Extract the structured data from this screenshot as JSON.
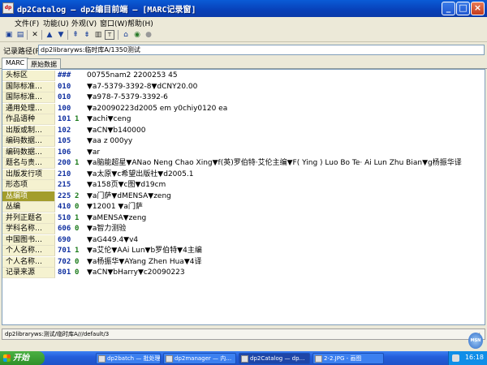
{
  "window": {
    "icon_text": "dp",
    "title": "dp2Catalog — dp2编目前端 — [MARC记录窗]",
    "minimize": "_",
    "maximize": "□",
    "close": "×"
  },
  "menu": [
    {
      "label": "文件(F)"
    },
    {
      "label": "功能(U)"
    },
    {
      "label": "外观(V)"
    },
    {
      "label": "窗口(W)"
    },
    {
      "label": "帮助(H)"
    }
  ],
  "toolbar": {
    "icons": [
      "save-icon",
      "save-as-icon",
      "delete-icon",
      "prev-icon",
      "next-icon",
      "first-icon",
      "last-icon",
      "print-icon",
      "template-icon",
      "search-icon",
      "load-icon",
      "stop-icon"
    ]
  },
  "path": {
    "label": "记录路径(P):",
    "value": "dp2libraryws:临时库A/1350测试"
  },
  "tabs": [
    {
      "label": "MARC"
    },
    {
      "label": "原始数据"
    }
  ],
  "marc": {
    "subfield_delimiter": "▼",
    "rows": [
      {
        "name": "头标区",
        "tag": "###",
        "ind": "",
        "value": "00755nam2 2200253   45"
      },
      {
        "name": "国际标准…",
        "tag": "010",
        "ind": "",
        "value": "▼a7-5379-3392-8▼dCNY20.00"
      },
      {
        "name": "国际标准…",
        "tag": "010",
        "ind": "",
        "value": "▼a978-7-5379-3392-6"
      },
      {
        "name": "通用处理…",
        "tag": "100",
        "ind": "",
        "value": "▼a20090223d2005    em y0chiy0120    ea"
      },
      {
        "name": "作品语种",
        "tag": "101",
        "ind": "1",
        "value": "▼achi▼ceng"
      },
      {
        "name": "出版或制…",
        "tag": "102",
        "ind": "",
        "value": "▼aCN▼b140000"
      },
      {
        "name": "编码数据…",
        "tag": "105",
        "ind": "",
        "value": "▼aa  z  000yy"
      },
      {
        "name": "编码数据…",
        "tag": "106",
        "ind": "",
        "value": "▼ar"
      },
      {
        "name": "题名与责…",
        "tag": "200",
        "ind": "1",
        "value": "▼a脑能超星▼ANao Neng Chao Xing▼f(英)罗伯特·艾伦主编▼F( Ying ) Luo Bo Te· Ai Lun Zhu Bian▼g杨振华译"
      },
      {
        "name": "出版发行项",
        "tag": "210",
        "ind": "",
        "value": "▼a太原▼c希望出版社▼d2005.1"
      },
      {
        "name": "形态项",
        "tag": "215",
        "ind": "",
        "value": "▼a158页▼c图▼d19cm"
      },
      {
        "name": "丛编项",
        "tag": "225",
        "ind": "2",
        "value": "▼a门萨▼dMENSA▼zeng",
        "selected": true
      },
      {
        "name": "丛编",
        "tag": "410",
        "ind": "0",
        "value": "▼12001 ▼a门萨"
      },
      {
        "name": "并列正题名",
        "tag": "510",
        "ind": "1",
        "value": "▼aMENSA▼zeng"
      },
      {
        "name": "学科名称…",
        "tag": "606",
        "ind": "0",
        "value": "▼a智力测验"
      },
      {
        "name": "中国图书…",
        "tag": "690",
        "ind": "",
        "value": "▼aG449.4▼v4"
      },
      {
        "name": "个人名称…",
        "tag": "701",
        "ind": "1",
        "value": "▼a艾伦▼AAi Lun▼b罗伯特▼4主编"
      },
      {
        "name": "个人名称…",
        "tag": "702",
        "ind": "0",
        "value": "▼a杨振华▼AYang Zhen Hua▼4译"
      },
      {
        "name": "记录来源",
        "tag": "801",
        "ind": "0",
        "value": "▼aCN▼bHarry▼c20090223"
      }
    ]
  },
  "status": {
    "text": "dp2libraryws:测试/临时库A///default/3"
  },
  "taskbar": {
    "start": "开始",
    "tasks": [
      {
        "label": "dp2batch — 批处理"
      },
      {
        "label": "dp2manager — 内…"
      },
      {
        "label": "dp2Catalog — dp…"
      },
      {
        "label": "2-2.JPG - 画图"
      }
    ],
    "clock": "16:18"
  },
  "msn": "MSN"
}
